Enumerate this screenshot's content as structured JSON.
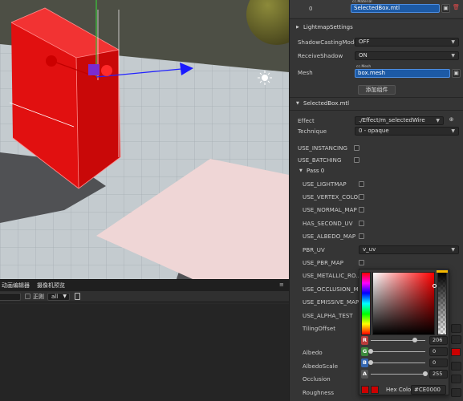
{
  "bottom_panel": {
    "tabs": [
      "动画编辑器",
      "摄像机预览"
    ],
    "toolbar": {
      "checkbox_label": "正则",
      "select_value": "all"
    }
  },
  "inspector": {
    "material_index": "0",
    "material_tag": "cc.Material",
    "material_value": "SelectedBox.mtl",
    "lightmap_section": "LightmapSettings",
    "shadow_casting_label": "ShadowCastingMode",
    "shadow_casting_value": "OFF",
    "receive_shadow_label": "ReceiveShadow",
    "receive_shadow_value": "ON",
    "mesh_label": "Mesh",
    "mesh_tag": "cc.Mesh",
    "mesh_value": "box.mesh",
    "add_component": "添加组件",
    "material_section": "SelectedBox.mtl",
    "effect_label": "Effect",
    "effect_value": "./Effect/m_selectedWire",
    "technique_label": "Technique",
    "technique_value": "0 - opaque",
    "use_instancing": "USE_INSTANCING",
    "use_batching": "USE_BATCHING",
    "pass_section": "Pass 0",
    "pass_flags": [
      "USE_LIGHTMAP",
      "USE_VERTEX_COLOR",
      "USE_NORMAL_MAP",
      "HAS_SECOND_UV",
      "USE_ALBEDO_MAP",
      "PBR_UV",
      "USE_PBR_MAP",
      "USE_METALLIC_RO...",
      "USE_OCCLUSION_M...",
      "USE_EMISSIVE_MAP",
      "USE_ALPHA_TEST"
    ],
    "pbr_uv_value": "v_uv",
    "tiling_offset": "TilingOffset",
    "albedo": "Albedo",
    "albedo_scale": "AlbedoScale",
    "occlusion": "Occlusion",
    "roughness": "Roughness"
  },
  "color_picker": {
    "channels": [
      {
        "label": "R",
        "value": "206",
        "fraction": 0.81,
        "color": "#b93b3b"
      },
      {
        "label": "G",
        "value": "0",
        "fraction": 0,
        "color": "#3c8a3c"
      },
      {
        "label": "B",
        "value": "0",
        "fraction": 0,
        "color": "#3466b0"
      },
      {
        "label": "A",
        "value": "255",
        "fraction": 1,
        "color": "#555555"
      }
    ],
    "hex_label": "Hex Color",
    "hex_value": "#CE0000"
  },
  "colors": {
    "cube_red": "#e10c0c",
    "selection_blue": "#1c5aa6",
    "albedo_swatch": "#ce0000"
  }
}
